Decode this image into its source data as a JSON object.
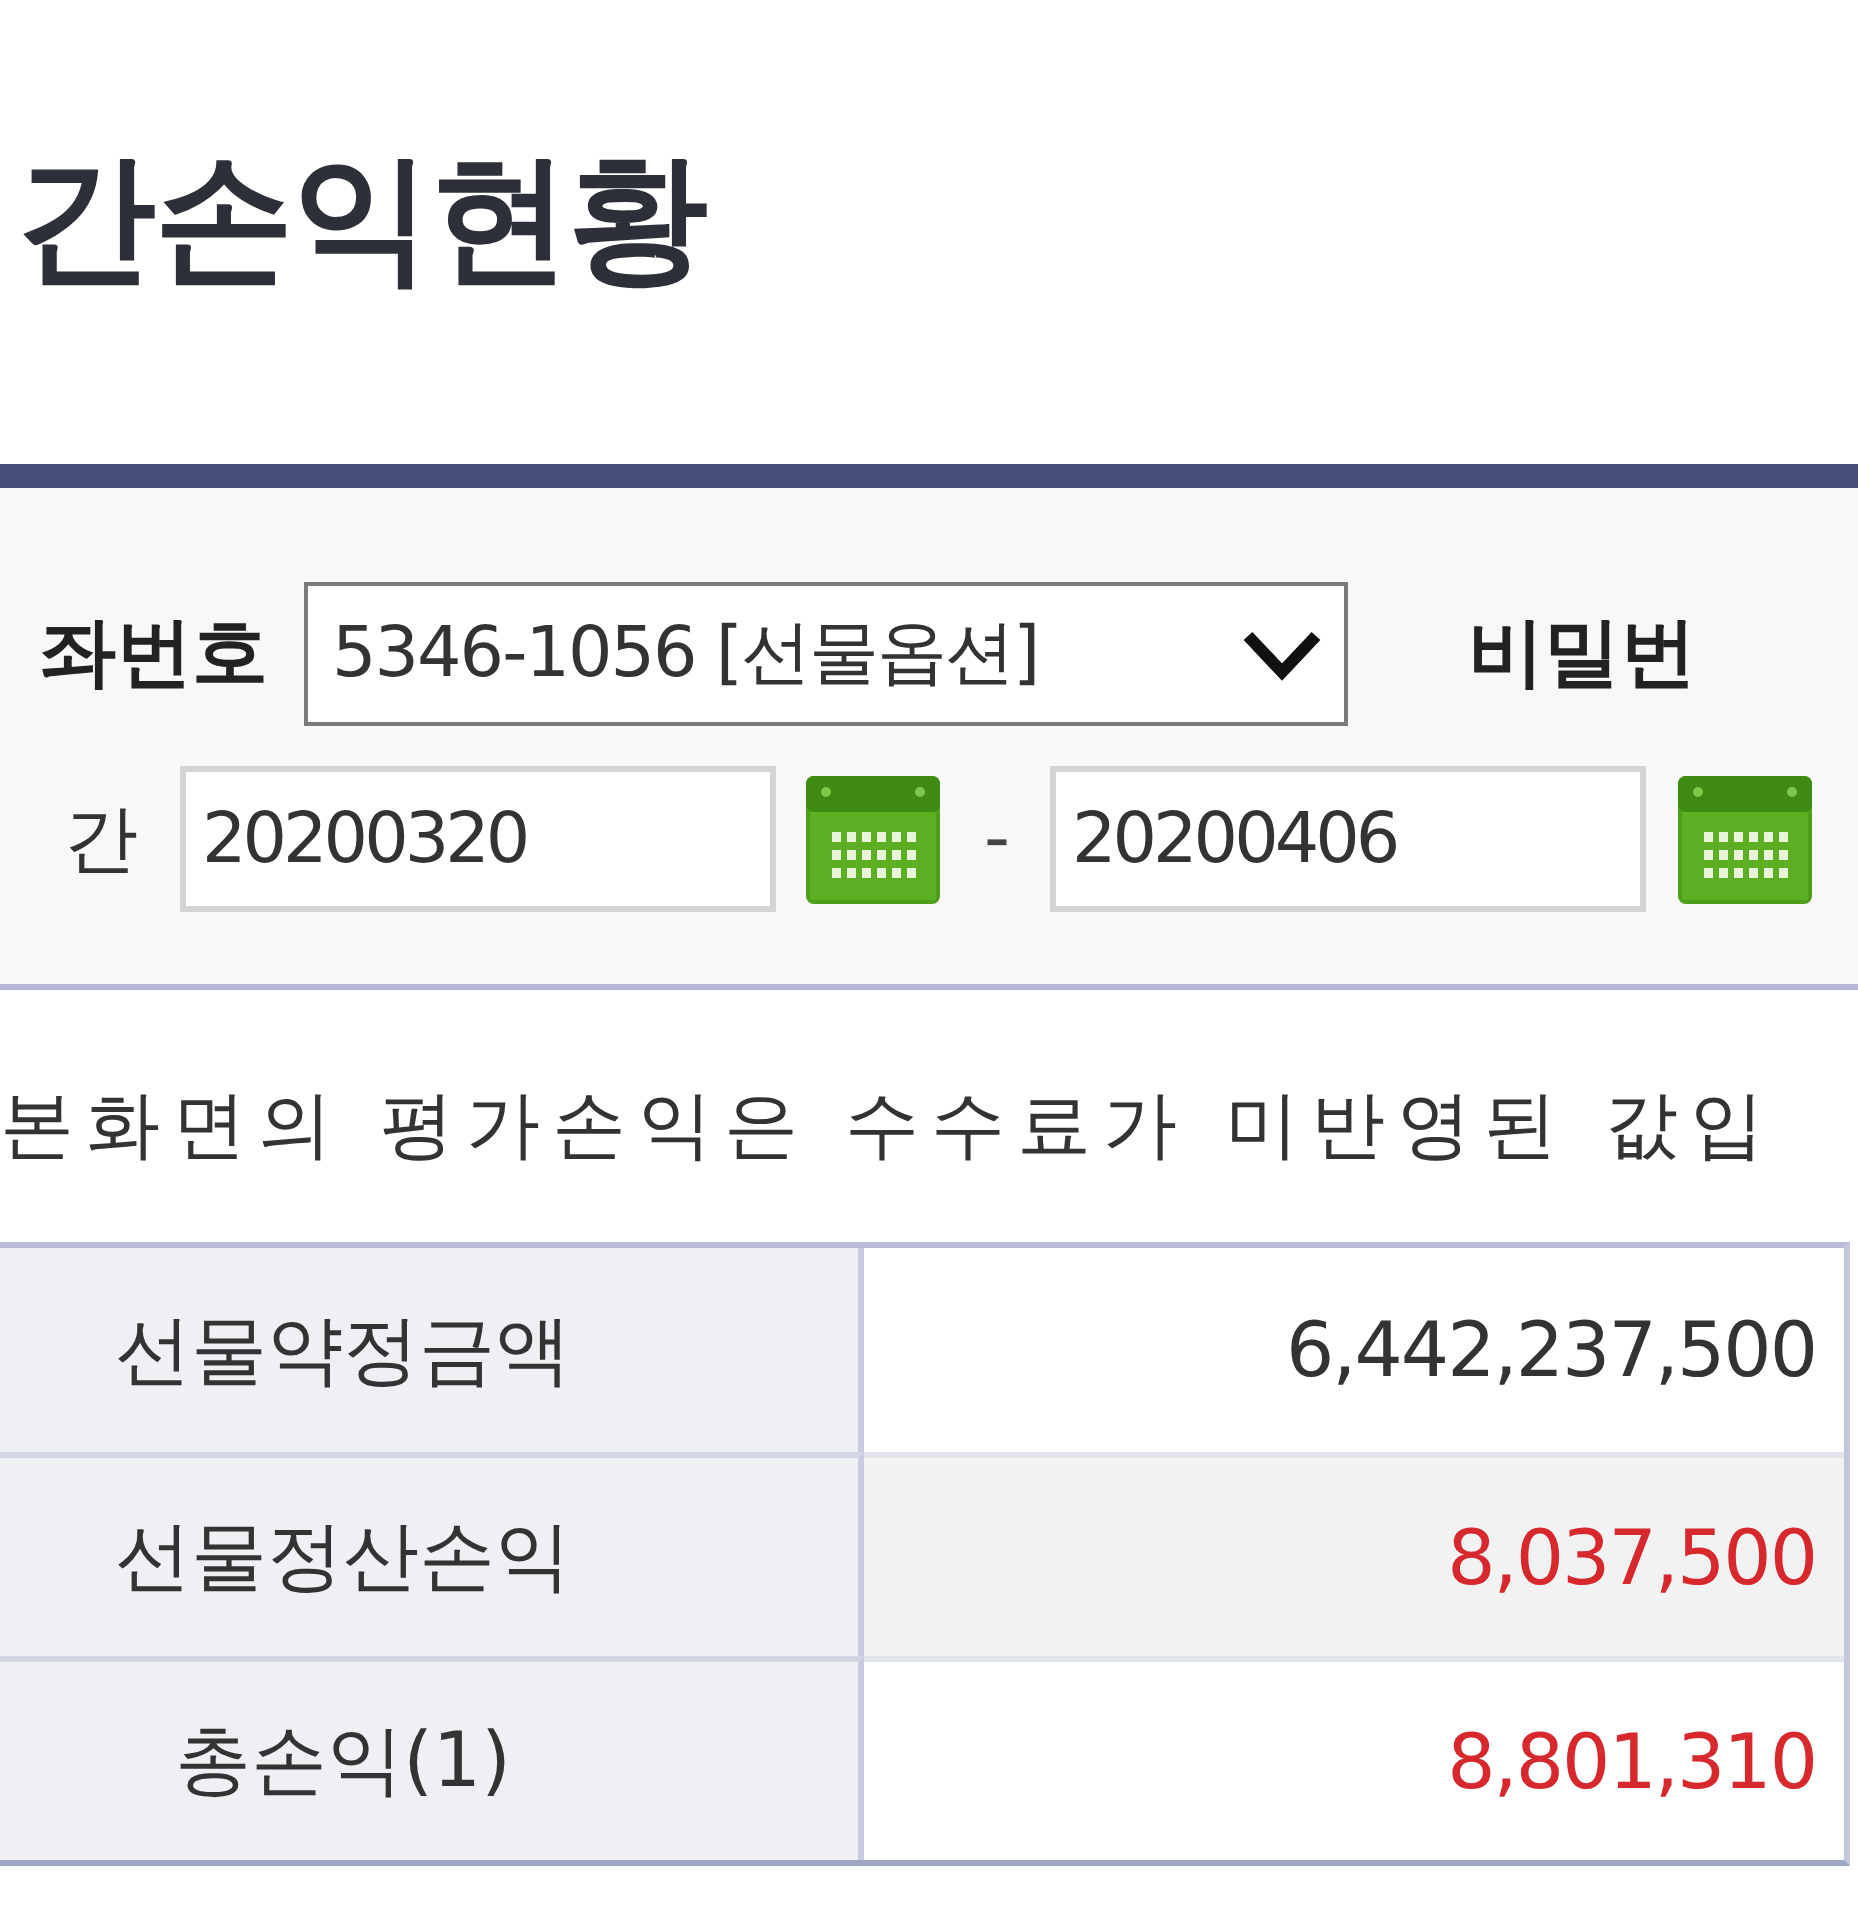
{
  "page_title": "간손익현황",
  "search_panel": {
    "account": {
      "label": "좌번호",
      "value": "5346-1056 [선물옵션]"
    },
    "password": {
      "label": "비밀번"
    },
    "period": {
      "label": "간",
      "start": "20200320",
      "separator": "-",
      "end": "20200406"
    }
  },
  "notice": "본화면의 평가손익은 수수료가 미반영된 값입",
  "summary_table": {
    "rows": [
      {
        "label": "선물약정금액",
        "value": "6,442,237,500",
        "color": "#333333"
      },
      {
        "label": "선물정산손익",
        "value": "8,037,500",
        "color": "#d7282e"
      },
      {
        "label": "총손익(1)",
        "value": "8,801,310",
        "color": "#d7282e"
      }
    ]
  }
}
